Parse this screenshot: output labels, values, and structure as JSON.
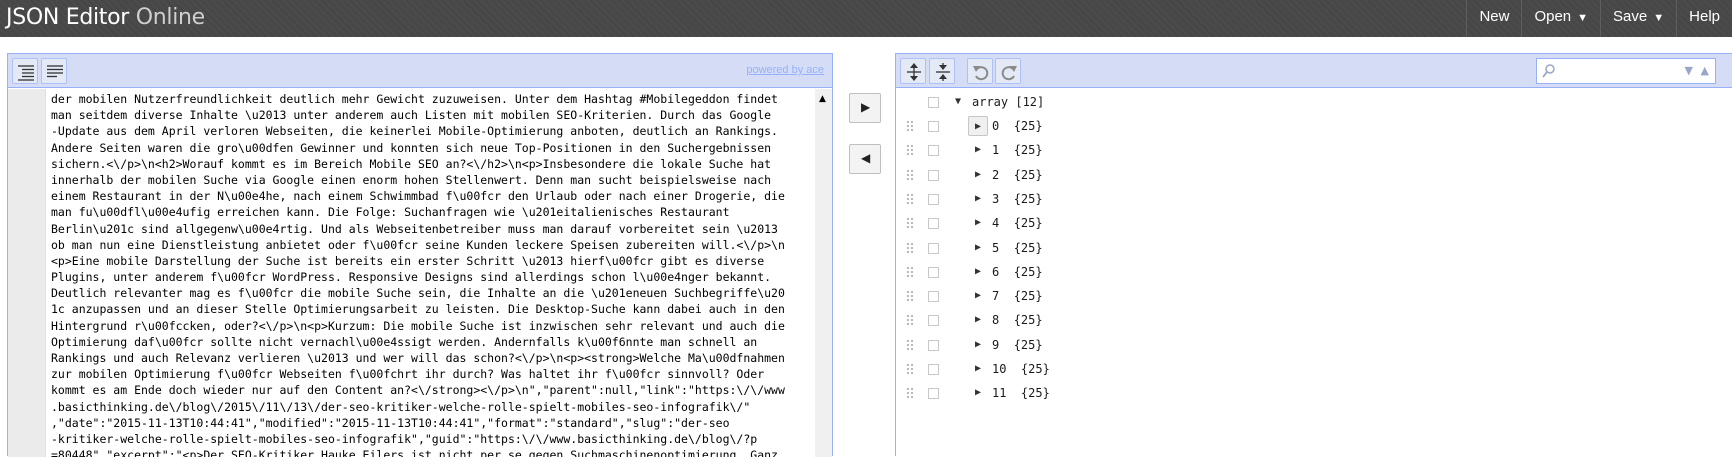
{
  "header": {
    "brand_part1": "JSON Editor",
    "brand_part2": "Online",
    "menu": [
      {
        "label": "New",
        "arrow": ""
      },
      {
        "label": "Open",
        "arrow": "▼"
      },
      {
        "label": "Save",
        "arrow": "▼"
      },
      {
        "label": "Help",
        "arrow": ""
      }
    ]
  },
  "code_panel": {
    "format_icon": "format-icon",
    "compact_icon": "compact-icon",
    "powered_by": "powered by ace",
    "lines": [
      "der mobilen Nutzerfreundlichkeit deutlich mehr Gewicht zuzuweisen. Unter dem Hashtag #Mobilegeddon findet",
      "man seitdem diverse Inhalte \\u2013 unter anderem auch Listen mit mobilen SEO-Kriterien. Durch das Google",
      "-Update aus dem April verloren Webseiten, die keinerlei Mobile-Optimierung anboten, deutlich an Rankings.",
      "Andere Seiten waren die gro\\u00dfen Gewinner und konnten sich neue Top-Positionen in den Suchergebnissen",
      "sichern.<\\/p>\\n<h2>Worauf kommt es im Bereich Mobile SEO an?<\\/h2>\\n<p>Insbesondere die lokale Suche hat",
      "innerhalb der mobilen Suche via Google einen enorm hohen Stellenwert. Denn man sucht beispielsweise nach",
      "einem Restaurant in der N\\u00e4he, nach einem Schwimmbad f\\u00fcr den Urlaub oder nach einer Drogerie, die",
      "man fu\\u00dfl\\u00e4ufig erreichen kann. Die Folge: Suchanfragen wie \\u201eitalienisches Restaurant",
      "Berlin\\u201c sind allgegenw\\u00e4rtig. Und als Webseitenbetreiber muss man darauf vorbereitet sein \\u2013",
      "ob man nun eine Dienstleistung anbietet oder f\\u00fcr seine Kunden leckere Speisen zubereiten will.<\\/p>\\n",
      "<p>Eine mobile Darstellung der Suche ist bereits ein erster Schritt \\u2013 hierf\\u00fcr gibt es diverse",
      "Plugins, unter anderem f\\u00fcr WordPress. Responsive Designs sind allerdings schon l\\u00e4nger bekannt.",
      "Deutlich relevanter mag es f\\u00fcr die mobile Suche sein, die Inhalte an die \\u201eneuen Suchbegriffe\\u20",
      "1c anzupassen und an dieser Stelle Optimierungsarbeit zu leisten. Die Desktop-Suche kann dabei auch in den",
      "Hintergrund r\\u00fccken, oder?<\\/p>\\n<p>Kurzum: Die mobile Suche ist inzwischen sehr relevant und auch die",
      "Optimierung daf\\u00fcr sollte nicht vernachl\\u00e4ssigt werden. Andernfalls k\\u00f6nnte man schnell an",
      "Rankings und auch Relevanz verlieren \\u2013 und wer will das schon?<\\/p>\\n<p><strong>Welche Ma\\u00dfnahmen",
      "zur mobilen Optimierung f\\u00fcr Webseiten f\\u00fchrt ihr durch? Was haltet ihr f\\u00fcr sinnvoll? Oder",
      "kommt es am Ende doch wieder nur auf den Content an?<\\/strong><\\/p>\\n\",\"parent\":null,\"link\":\"https:\\/\\/www",
      ".basicthinking.de\\/blog\\/2015\\/11\\/13\\/der-seo-kritiker-welche-rolle-spielt-mobiles-seo-infografik\\/\"",
      ",\"date\":\"2015-11-13T10:44:41\",\"modified\":\"2015-11-13T10:44:41\",\"format\":\"standard\",\"slug\":\"der-seo",
      "-kritiker-welche-rolle-spielt-mobiles-seo-infografik\",\"guid\":\"https:\\/\\/www.basicthinking.de\\/blog\\/?p",
      "=80448\",\"excerpt\":\"<p>Der SEO-Kritiker Hauke Eilers ist nicht per se gegen Suchmaschinenoptimierung. Ganz"
    ]
  },
  "transfer": {
    "to_tree_icon": "▶",
    "to_code_icon": "◀"
  },
  "tree_panel": {
    "root": {
      "field": "array",
      "value": "[12]"
    },
    "items": [
      {
        "field": "0",
        "value": "{25}"
      },
      {
        "field": "1",
        "value": "{25}"
      },
      {
        "field": "2",
        "value": "{25}"
      },
      {
        "field": "3",
        "value": "{25}"
      },
      {
        "field": "4",
        "value": "{25}"
      },
      {
        "field": "5",
        "value": "{25}"
      },
      {
        "field": "6",
        "value": "{25}"
      },
      {
        "field": "7",
        "value": "{25}"
      },
      {
        "field": "8",
        "value": "{25}"
      },
      {
        "field": "9",
        "value": "{25}"
      },
      {
        "field": "10",
        "value": "{25}"
      },
      {
        "field": "11",
        "value": "{25}"
      }
    ],
    "search": {
      "value": ""
    }
  }
}
